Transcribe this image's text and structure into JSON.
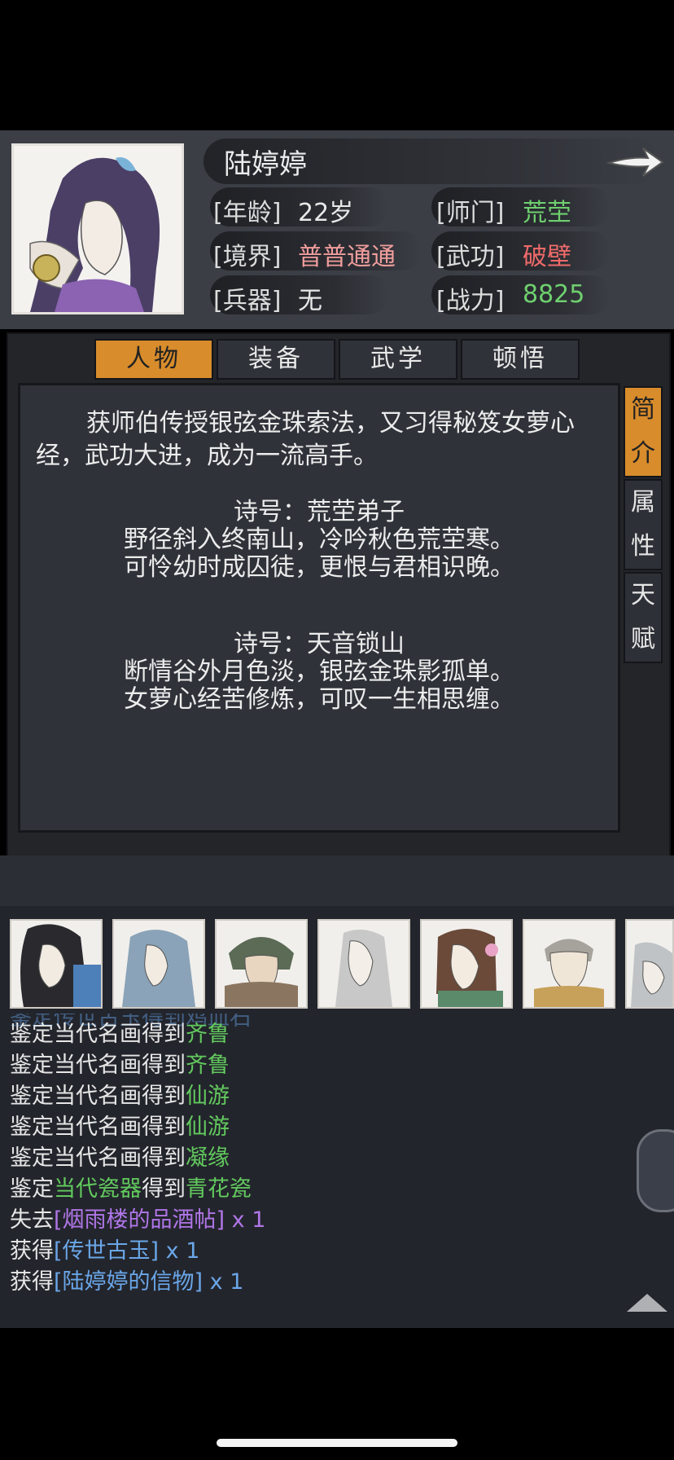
{
  "character": {
    "name": "陆婷婷",
    "rows": [
      {
        "l1": "[年龄]",
        "v1": "22岁",
        "l2": "[师门]",
        "v2": "荒茔"
      },
      {
        "l1": "[境界]",
        "v1": "普普通通",
        "l2": "[武功]",
        "v2": "破壁"
      },
      {
        "l1": "[兵器]",
        "v1": "无",
        "l2": "[战力]",
        "v2": "8825"
      }
    ]
  },
  "tabs": [
    "人物",
    "装备",
    "武学",
    "顿悟"
  ],
  "side_tabs": [
    [
      "简",
      "介"
    ],
    [
      "属",
      "性"
    ],
    [
      "天",
      "赋"
    ]
  ],
  "intro": {
    "paragraph": "获师伯传授银弦金珠索法，又习得秘笈女萝心经，武功大进，成为一流高手。",
    "poems": [
      {
        "title": "诗号：荒茔弟子",
        "line1": "野径斜入终南山，冷吟秋色荒茔寒。",
        "line2": "可怜幼时成囚徒，更恨与君相识晚。"
      },
      {
        "title": "诗号：天音锁山",
        "line1": "断情谷外月色淡，银弦金珠影孤单。",
        "line2": "女萝心经苦修炼，可叹一生相思缠。"
      }
    ]
  },
  "log": [
    {
      "a": "鉴定当代名画得到",
      "b": "齐鲁",
      "c": ""
    },
    {
      "a": "鉴定当代名画得到",
      "b": "齐鲁",
      "c": ""
    },
    {
      "a": "鉴定当代名画得到",
      "b": "仙游",
      "c": ""
    },
    {
      "a": "鉴定当代名画得到",
      "b": "仙游",
      "c": ""
    },
    {
      "a": "鉴定当代名画得到",
      "b": "凝缘",
      "c": ""
    },
    {
      "a": "鉴定",
      "b": "当代瓷器",
      "c": "得到",
      "d": "青花瓷"
    },
    {
      "a": "失去",
      "item": "[烟雨楼的品酒帖]",
      "qty": " x 1",
      "color": "p"
    },
    {
      "a": "获得",
      "item": "[传世古玉]",
      "qty": " x 1",
      "color": "b"
    },
    {
      "a": "获得",
      "item": "[陆婷婷的信物]",
      "qty": " x 1",
      "color": "b"
    }
  ],
  "log_partial": "鉴定传世古玉得到鸡血石"
}
